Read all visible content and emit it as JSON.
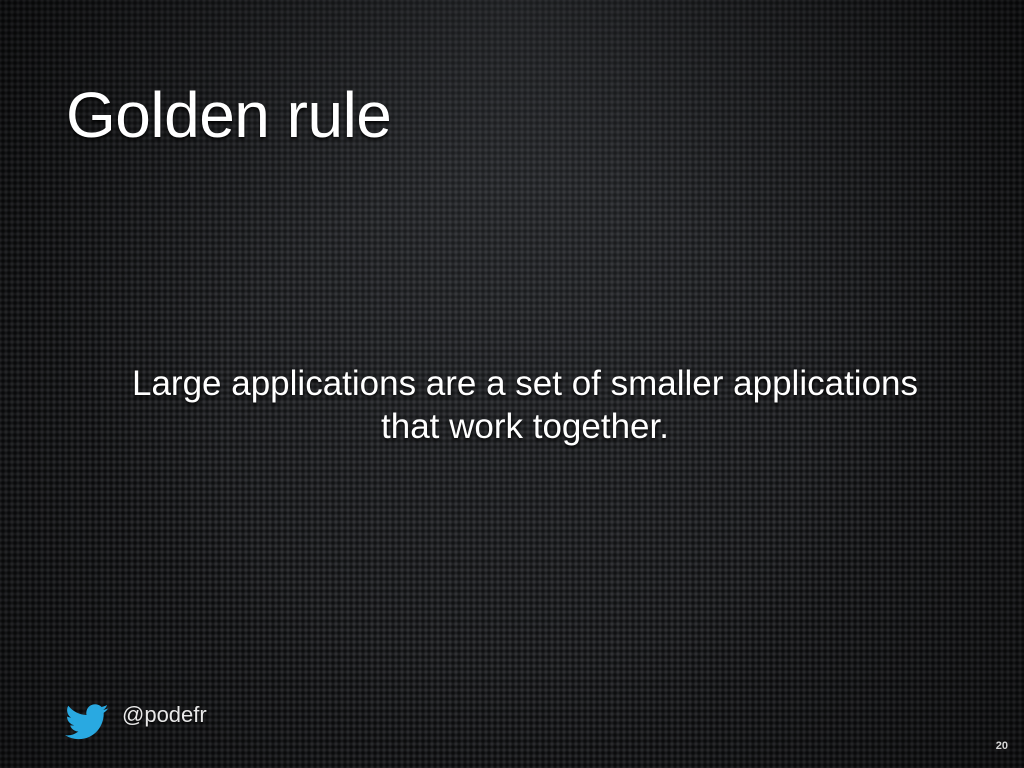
{
  "slide": {
    "title": "Golden rule",
    "body": "Large applications are a set of smaller applications that work together.",
    "footer": {
      "icon": "twitter-bird-icon",
      "handle": "@podefr",
      "icon_color": "#29a9e1"
    },
    "page_number": "20"
  }
}
